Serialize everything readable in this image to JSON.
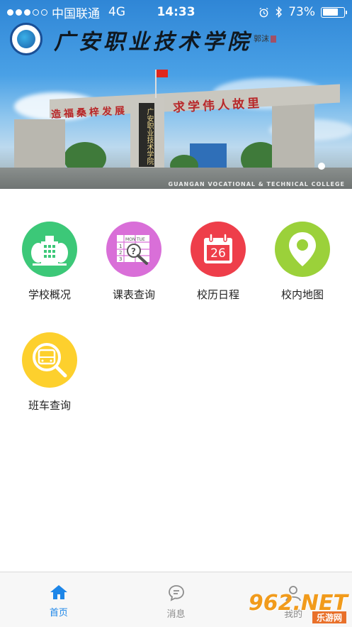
{
  "status_bar": {
    "carrier": "中国联通",
    "network": "4G",
    "time": "14:33",
    "battery_percent": "73%",
    "battery_level": 0.73
  },
  "banner": {
    "college_name": "广安职业技术学院",
    "calligraphy_signature": "郭沫",
    "gate_text_left": "造福桑梓发展",
    "gate_text_right": "求学伟人故里",
    "pillar_text": "广安职业技术学院",
    "caption": "GUANGAN VOCATIONAL & TECHNICAL COLLEGE",
    "page_indicator": {
      "current": 1,
      "total": 1
    }
  },
  "features": [
    {
      "label": "学校概况",
      "icon": "school-building-icon",
      "color": "#3cc878"
    },
    {
      "label": "课表查询",
      "icon": "timetable-search-icon",
      "color": "#d96fd8"
    },
    {
      "label": "校历日程",
      "icon": "calendar-icon",
      "color": "#ee3e4a",
      "calendar_day": "26"
    },
    {
      "label": "校内地图",
      "icon": "map-pin-icon",
      "color": "#9bd13a"
    },
    {
      "label": "班车查询",
      "icon": "bus-search-icon",
      "color": "#fdd02d"
    }
  ],
  "tabs": [
    {
      "label": "首页",
      "icon": "home-icon",
      "active": true
    },
    {
      "label": "消息",
      "icon": "message-icon",
      "active": false
    },
    {
      "label": "我的",
      "icon": "user-icon",
      "active": false
    }
  ],
  "watermark": {
    "brand": "962.NET",
    "sub": "乐游网"
  },
  "colors": {
    "accent": "#1d86e8",
    "inactive": "#8c8c8c"
  }
}
